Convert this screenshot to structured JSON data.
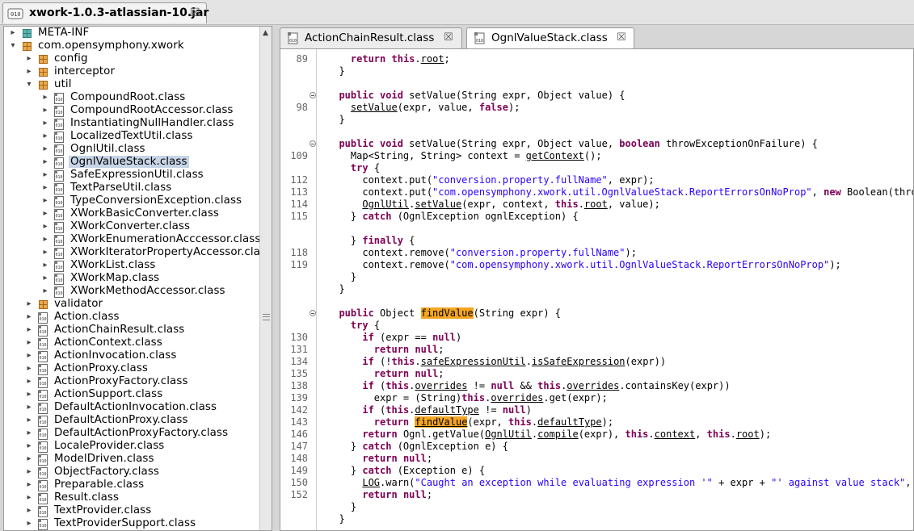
{
  "top_tab": {
    "title": "xwork-1.0.3-atlassian-10.jar",
    "close": "☒",
    "icon": "jar-icon"
  },
  "tree": {
    "rows": [
      {
        "label": "META-INF",
        "type": "meta",
        "depth": 0,
        "toggle": "+"
      },
      {
        "label": "com.opensymphony.xwork",
        "type": "pkg",
        "depth": 0,
        "toggle": "−"
      },
      {
        "label": "config",
        "type": "pkg",
        "depth": 1,
        "toggle": "+"
      },
      {
        "label": "interceptor",
        "type": "pkg",
        "depth": 1,
        "toggle": "+"
      },
      {
        "label": "util",
        "type": "pkg",
        "depth": 1,
        "toggle": "−"
      },
      {
        "label": "CompoundRoot.class",
        "type": "class",
        "depth": 2,
        "toggle": "+"
      },
      {
        "label": "CompoundRootAccessor.class",
        "type": "class",
        "depth": 2,
        "toggle": "+"
      },
      {
        "label": "InstantiatingNullHandler.class",
        "type": "class",
        "depth": 2,
        "toggle": "+"
      },
      {
        "label": "LocalizedTextUtil.class",
        "type": "class",
        "depth": 2,
        "toggle": "+"
      },
      {
        "label": "OgnlUtil.class",
        "type": "class",
        "depth": 2,
        "toggle": "+"
      },
      {
        "label": "OgnlValueStack.class",
        "type": "class",
        "depth": 2,
        "toggle": "+",
        "selected": true
      },
      {
        "label": "SafeExpressionUtil.class",
        "type": "class",
        "depth": 2,
        "toggle": "+"
      },
      {
        "label": "TextParseUtil.class",
        "type": "class",
        "depth": 2,
        "toggle": "+"
      },
      {
        "label": "TypeConversionException.class",
        "type": "class",
        "depth": 2,
        "toggle": "+"
      },
      {
        "label": "XWorkBasicConverter.class",
        "type": "class",
        "depth": 2,
        "toggle": "+"
      },
      {
        "label": "XWorkConverter.class",
        "type": "class",
        "depth": 2,
        "toggle": "+"
      },
      {
        "label": "XWorkEnumerationAcccessor.class",
        "type": "class",
        "depth": 2,
        "toggle": "+"
      },
      {
        "label": "XWorkIteratorPropertyAccessor.class",
        "type": "class",
        "depth": 2,
        "toggle": "+"
      },
      {
        "label": "XWorkList.class",
        "type": "class",
        "depth": 2,
        "toggle": "+"
      },
      {
        "label": "XWorkMap.class",
        "type": "class",
        "depth": 2,
        "toggle": "+"
      },
      {
        "label": "XWorkMethodAccessor.class",
        "type": "class",
        "depth": 2,
        "toggle": "+"
      },
      {
        "label": "validator",
        "type": "pkg",
        "depth": 1,
        "toggle": "+"
      },
      {
        "label": "Action.class",
        "type": "class",
        "depth": 1,
        "toggle": "+"
      },
      {
        "label": "ActionChainResult.class",
        "type": "class",
        "depth": 1,
        "toggle": "+"
      },
      {
        "label": "ActionContext.class",
        "type": "class",
        "depth": 1,
        "toggle": "+"
      },
      {
        "label": "ActionInvocation.class",
        "type": "class",
        "depth": 1,
        "toggle": "+"
      },
      {
        "label": "ActionProxy.class",
        "type": "class",
        "depth": 1,
        "toggle": "+"
      },
      {
        "label": "ActionProxyFactory.class",
        "type": "class",
        "depth": 1,
        "toggle": "+"
      },
      {
        "label": "ActionSupport.class",
        "type": "class",
        "depth": 1,
        "toggle": "+"
      },
      {
        "label": "DefaultActionInvocation.class",
        "type": "class",
        "depth": 1,
        "toggle": "+"
      },
      {
        "label": "DefaultActionProxy.class",
        "type": "class",
        "depth": 1,
        "toggle": "+"
      },
      {
        "label": "DefaultActionProxyFactory.class",
        "type": "class",
        "depth": 1,
        "toggle": "+"
      },
      {
        "label": "LocaleProvider.class",
        "type": "class",
        "depth": 1,
        "toggle": "+"
      },
      {
        "label": "ModelDriven.class",
        "type": "class",
        "depth": 1,
        "toggle": "+"
      },
      {
        "label": "ObjectFactory.class",
        "type": "class",
        "depth": 1,
        "toggle": "+"
      },
      {
        "label": "Preparable.class",
        "type": "class",
        "depth": 1,
        "toggle": "+"
      },
      {
        "label": "Result.class",
        "type": "class",
        "depth": 1,
        "toggle": "+"
      },
      {
        "label": "TextProvider.class",
        "type": "class",
        "depth": 1,
        "toggle": "+"
      },
      {
        "label": "TextProviderSupport.class",
        "type": "class",
        "depth": 1,
        "toggle": "+"
      }
    ],
    "class_icon_text": "010"
  },
  "editor": {
    "tabs": [
      {
        "title": "ActionChainResult.class",
        "close": "☒",
        "active": false
      },
      {
        "title": "OgnlValueStack.class",
        "close": "☒",
        "active": true
      }
    ],
    "lines": [
      {
        "ln": "89",
        "code": [
          [
            "    ",
            ""
          ],
          [
            "return",
            "kw"
          ],
          [
            " ",
            ""
          ],
          [
            "this",
            "kw"
          ],
          [
            ".",
            ""
          ],
          [
            "root",
            "ul"
          ],
          [
            ";",
            ""
          ]
        ]
      },
      {
        "ln": "",
        "code": [
          [
            "  }",
            ""
          ]
        ]
      },
      {
        "ln": "",
        "code": [
          [
            "",
            ""
          ]
        ]
      },
      {
        "ln": "",
        "fold": true,
        "code": [
          [
            "  ",
            ""
          ],
          [
            "public",
            "kw"
          ],
          [
            " ",
            ""
          ],
          [
            "void",
            "kw"
          ],
          [
            " setValue(String expr, Object value) {",
            ""
          ]
        ]
      },
      {
        "ln": "98",
        "code": [
          [
            "    ",
            ""
          ],
          [
            "setValue",
            "ul"
          ],
          [
            "(expr, value, ",
            ""
          ],
          [
            "false",
            "kw"
          ],
          [
            ");",
            ""
          ]
        ]
      },
      {
        "ln": "",
        "code": [
          [
            "  }",
            ""
          ]
        ]
      },
      {
        "ln": "",
        "code": [
          [
            "",
            ""
          ]
        ]
      },
      {
        "ln": "",
        "fold": true,
        "code": [
          [
            "  ",
            ""
          ],
          [
            "public",
            "kw"
          ],
          [
            " ",
            ""
          ],
          [
            "void",
            "kw"
          ],
          [
            " setValue(String expr, Object value, ",
            ""
          ],
          [
            "boolean",
            "kw"
          ],
          [
            " throwExceptionOnFailure) {",
            ""
          ]
        ]
      },
      {
        "ln": "109",
        "code": [
          [
            "    Map<String, String> context = ",
            ""
          ],
          [
            "getContext",
            "ul"
          ],
          [
            "();",
            ""
          ]
        ]
      },
      {
        "ln": "",
        "code": [
          [
            "    ",
            ""
          ],
          [
            "try",
            "kw"
          ],
          [
            " {",
            ""
          ]
        ]
      },
      {
        "ln": "112",
        "code": [
          [
            "      context.put(",
            ""
          ],
          [
            "\"conversion.property.fullName\"",
            "str"
          ],
          [
            ", expr);",
            ""
          ]
        ]
      },
      {
        "ln": "113",
        "code": [
          [
            "      context.put(",
            ""
          ],
          [
            "\"com.opensymphony.xwork.util.OgnlValueStack.ReportErrorsOnNoProp\"",
            "str"
          ],
          [
            ", ",
            ""
          ],
          [
            "new",
            "kw"
          ],
          [
            " Boolean(throwExceptionOnFailure));",
            ""
          ]
        ]
      },
      {
        "ln": "114",
        "code": [
          [
            "      ",
            ""
          ],
          [
            "OgnlUtil",
            "ul"
          ],
          [
            ".",
            ""
          ],
          [
            "setValue",
            "ul"
          ],
          [
            "(expr, context, ",
            ""
          ],
          [
            "this",
            "kw"
          ],
          [
            ".",
            ""
          ],
          [
            "root",
            "ul"
          ],
          [
            ", value);",
            ""
          ]
        ]
      },
      {
        "ln": "115",
        "code": [
          [
            "    } ",
            ""
          ],
          [
            "catch",
            "kw"
          ],
          [
            " (OgnlException ognlException) {",
            ""
          ]
        ]
      },
      {
        "ln": "",
        "code": [
          [
            "",
            ""
          ]
        ]
      },
      {
        "ln": "",
        "code": [
          [
            "    } ",
            ""
          ],
          [
            "finally",
            "kw"
          ],
          [
            " {",
            ""
          ]
        ]
      },
      {
        "ln": "118",
        "code": [
          [
            "      context.remove(",
            ""
          ],
          [
            "\"conversion.property.fullName\"",
            "str"
          ],
          [
            ");",
            ""
          ]
        ]
      },
      {
        "ln": "119",
        "code": [
          [
            "      context.remove(",
            ""
          ],
          [
            "\"com.opensymphony.xwork.util.OgnlValueStack.ReportErrorsOnNoProp\"",
            "str"
          ],
          [
            ");",
            ""
          ]
        ]
      },
      {
        "ln": "",
        "code": [
          [
            "    }",
            ""
          ]
        ]
      },
      {
        "ln": "",
        "code": [
          [
            "  }",
            ""
          ]
        ]
      },
      {
        "ln": "",
        "code": [
          [
            "",
            ""
          ]
        ]
      },
      {
        "ln": "",
        "fold": true,
        "code": [
          [
            "  ",
            ""
          ],
          [
            "public",
            "kw"
          ],
          [
            " Object ",
            ""
          ],
          [
            "findValue",
            "hl"
          ],
          [
            "(String expr) {",
            ""
          ]
        ]
      },
      {
        "ln": "",
        "code": [
          [
            "    ",
            ""
          ],
          [
            "try",
            "kw"
          ],
          [
            " {",
            ""
          ]
        ]
      },
      {
        "ln": "130",
        "code": [
          [
            "      ",
            ""
          ],
          [
            "if",
            "kw"
          ],
          [
            " (expr == ",
            ""
          ],
          [
            "null",
            "kw"
          ],
          [
            ")",
            ""
          ]
        ]
      },
      {
        "ln": "131",
        "code": [
          [
            "        ",
            ""
          ],
          [
            "return",
            "kw"
          ],
          [
            " ",
            ""
          ],
          [
            "null",
            "kw"
          ],
          [
            ";",
            ""
          ]
        ]
      },
      {
        "ln": "134",
        "code": [
          [
            "      ",
            ""
          ],
          [
            "if",
            "kw"
          ],
          [
            " (!",
            ""
          ],
          [
            "this",
            "kw"
          ],
          [
            ".",
            ""
          ],
          [
            "safeExpressionUtil",
            "ul"
          ],
          [
            ".",
            ""
          ],
          [
            "isSafeExpression",
            "ul"
          ],
          [
            "(expr))",
            ""
          ]
        ]
      },
      {
        "ln": "135",
        "code": [
          [
            "        ",
            ""
          ],
          [
            "return",
            "kw"
          ],
          [
            " ",
            ""
          ],
          [
            "null",
            "kw"
          ],
          [
            ";",
            ""
          ]
        ]
      },
      {
        "ln": "138",
        "code": [
          [
            "      ",
            ""
          ],
          [
            "if",
            "kw"
          ],
          [
            " (",
            ""
          ],
          [
            "this",
            "kw"
          ],
          [
            ".",
            ""
          ],
          [
            "overrides",
            "ul"
          ],
          [
            " != ",
            ""
          ],
          [
            "null",
            "kw"
          ],
          [
            " && ",
            ""
          ],
          [
            "this",
            "kw"
          ],
          [
            ".",
            ""
          ],
          [
            "overrides",
            "ul"
          ],
          [
            ".containsKey(expr))",
            ""
          ]
        ]
      },
      {
        "ln": "139",
        "code": [
          [
            "        expr = (String)",
            ""
          ],
          [
            "this",
            "kw"
          ],
          [
            ".",
            ""
          ],
          [
            "overrides",
            "ul"
          ],
          [
            ".get(expr);",
            ""
          ]
        ]
      },
      {
        "ln": "142",
        "code": [
          [
            "      ",
            ""
          ],
          [
            "if",
            "kw"
          ],
          [
            " (",
            ""
          ],
          [
            "this",
            "kw"
          ],
          [
            ".",
            ""
          ],
          [
            "defaultType",
            "ul"
          ],
          [
            " != ",
            ""
          ],
          [
            "null",
            "kw"
          ],
          [
            ")",
            ""
          ]
        ]
      },
      {
        "ln": "143",
        "code": [
          [
            "        ",
            ""
          ],
          [
            "return",
            "kw"
          ],
          [
            " ",
            ""
          ],
          [
            "findValue",
            "hlu"
          ],
          [
            "(expr, ",
            ""
          ],
          [
            "this",
            "kw"
          ],
          [
            ".",
            ""
          ],
          [
            "defaultType",
            "ul"
          ],
          [
            ");",
            ""
          ]
        ]
      },
      {
        "ln": "146",
        "code": [
          [
            "      ",
            ""
          ],
          [
            "return",
            "kw"
          ],
          [
            " Ognl.getValue(",
            ""
          ],
          [
            "OgnlUtil",
            "ul"
          ],
          [
            ".",
            ""
          ],
          [
            "compile",
            "ul"
          ],
          [
            "(expr), ",
            ""
          ],
          [
            "this",
            "kw"
          ],
          [
            ".",
            ""
          ],
          [
            "context",
            "ul"
          ],
          [
            ", ",
            ""
          ],
          [
            "this",
            "kw"
          ],
          [
            ".",
            ""
          ],
          [
            "root",
            "ul"
          ],
          [
            ");",
            ""
          ]
        ]
      },
      {
        "ln": "147",
        "code": [
          [
            "    } ",
            ""
          ],
          [
            "catch",
            "kw"
          ],
          [
            " (OgnlException e) {",
            ""
          ]
        ]
      },
      {
        "ln": "148",
        "code": [
          [
            "      ",
            ""
          ],
          [
            "return",
            "kw"
          ],
          [
            " ",
            ""
          ],
          [
            "null",
            "kw"
          ],
          [
            ";",
            ""
          ]
        ]
      },
      {
        "ln": "149",
        "code": [
          [
            "    } ",
            ""
          ],
          [
            "catch",
            "kw"
          ],
          [
            " (Exception e) {",
            ""
          ]
        ]
      },
      {
        "ln": "150",
        "code": [
          [
            "      ",
            ""
          ],
          [
            "LOG",
            "ul"
          ],
          [
            ".warn(",
            ""
          ],
          [
            "\"Caught an exception while evaluating expression '\"",
            "str"
          ],
          [
            " + expr + ",
            ""
          ],
          [
            "\"' against value stack\"",
            "str"
          ],
          [
            ", e);",
            ""
          ]
        ]
      },
      {
        "ln": "152",
        "code": [
          [
            "      ",
            ""
          ],
          [
            "return",
            "kw"
          ],
          [
            " ",
            ""
          ],
          [
            "null",
            "kw"
          ],
          [
            ";",
            ""
          ]
        ]
      },
      {
        "ln": "",
        "code": [
          [
            "    }",
            ""
          ]
        ]
      },
      {
        "ln": "",
        "code": [
          [
            "  }",
            ""
          ]
        ]
      }
    ]
  },
  "colors": {
    "keyword": "#7f0055",
    "string": "#2a00ff",
    "highlight": "#f5a623",
    "selection": "#c6d4e6"
  }
}
